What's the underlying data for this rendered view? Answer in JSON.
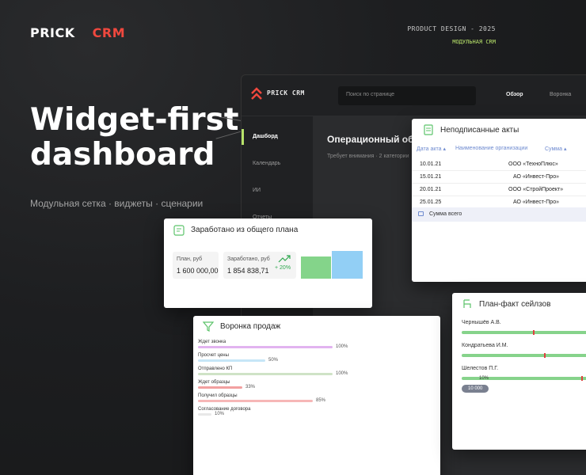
{
  "brand": {
    "part1": "PRICK",
    "part2": "CRM"
  },
  "meta": {
    "line1": "PRODUCT DESIGN - 2025",
    "line2": "МОДУЛЬНАЯ CRM"
  },
  "hero": {
    "title_line1": "Widget-first",
    "title_line2": "dashboard",
    "subtitle": "Модульная сетка · виджеты · сценарии"
  },
  "app": {
    "name": "PRICK CRM",
    "search_placeholder": "Поиск по странице",
    "nav": [
      "Обзор",
      "Воронка"
    ],
    "sidebar": [
      "Дашборд",
      "Календарь",
      "ИИ",
      "Отчеты"
    ],
    "main_title": "Операционный обзор",
    "main_sub": "Требует внимания  ·  2 категории"
  },
  "acts": {
    "title": "Неподписанные акты",
    "headers": [
      "Дата акта ▴",
      "Наименование организации",
      "Сумма ▴"
    ],
    "rows": [
      {
        "date": "10.01.21",
        "org": "ООО «ТехноПлюс»"
      },
      {
        "date": "15.01.21",
        "org": "АО «Инвест-Про»"
      },
      {
        "date": "20.01.21",
        "org": "ООО «СтройПроект»"
      },
      {
        "date": "25.01.25",
        "org": "АО «Инвест-Про»"
      }
    ],
    "total_label": "Сумма всего"
  },
  "earned": {
    "title": "Заработано из общего плана",
    "plan_label": "План, руб",
    "plan_value": "1 600 000,00",
    "earned_label": "Заработано, руб",
    "earned_value": "1 854 838,71",
    "percent": "+ 20%",
    "bars": {
      "plan": 0.8,
      "earned": 1.0
    },
    "colors": {
      "plan": "#84d48a",
      "earned": "#92cff5"
    }
  },
  "funnel": {
    "title": "Воронка продаж",
    "stages": [
      {
        "label": "Ждет звонка",
        "pct": "100%",
        "value": 1.0,
        "color": "#e2b3f0"
      },
      {
        "label": "Просчет цены",
        "pct": "50%",
        "value": 0.5,
        "color": "#c6e6f7"
      },
      {
        "label": "Отправлено КП",
        "pct": "100%",
        "value": 1.0,
        "color": "#cfe3c6"
      },
      {
        "label": "Ждет образцы",
        "pct": "33%",
        "value": 0.33,
        "color": "#f2a0a0"
      },
      {
        "label": "Получил образцы",
        "pct": "85%",
        "value": 0.85,
        "color": "#f6b7b7"
      },
      {
        "label": "Согласование договора",
        "pct": "10%",
        "value": 0.1,
        "color": "#e8e8e8"
      }
    ]
  },
  "plan_fact": {
    "title": "План-факт сейлзов",
    "people": [
      {
        "name": "Чернышёв А.В.",
        "fact": 0.5
      },
      {
        "name": "Кондратьева И.М.",
        "fact": 0.58
      },
      {
        "name": "Шелестов П.Г.",
        "fact": 0.84
      }
    ],
    "small_pct": "10%",
    "tag": "10 000"
  }
}
